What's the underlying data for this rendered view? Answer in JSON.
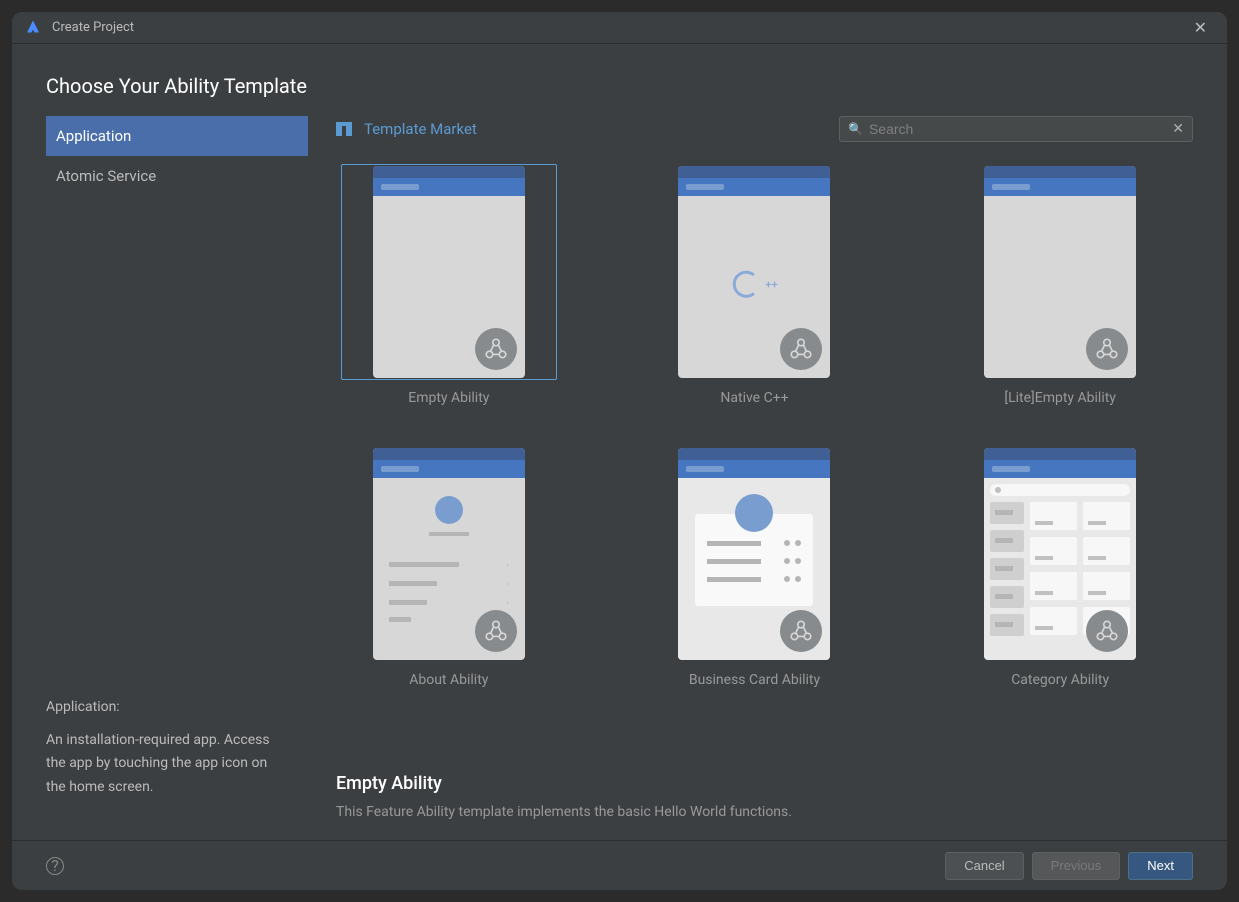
{
  "window": {
    "title": "Create Project"
  },
  "heading": "Choose Your Ability Template",
  "sidebar": {
    "items": [
      {
        "label": "Application",
        "selected": true
      },
      {
        "label": "Atomic Service",
        "selected": false
      }
    ],
    "description_title": "Application:",
    "description_text": "An installation-required app. Access the app by touching the app icon on the home screen."
  },
  "market_link": "Template Market",
  "search": {
    "placeholder": "Search",
    "value": ""
  },
  "templates": [
    {
      "label": "Empty Ability",
      "preview": "empty",
      "selected": true
    },
    {
      "label": "Native C++",
      "preview": "cpp",
      "selected": false
    },
    {
      "label": "[Lite]Empty Ability",
      "preview": "empty",
      "selected": false
    },
    {
      "label": "About Ability",
      "preview": "about",
      "selected": false
    },
    {
      "label": "Business Card Ability",
      "preview": "biz",
      "selected": false
    },
    {
      "label": "Category Ability",
      "preview": "cat",
      "selected": false
    }
  ],
  "detail": {
    "title": "Empty Ability",
    "description": "This Feature Ability template implements the basic Hello World functions."
  },
  "footer": {
    "cancel": "Cancel",
    "previous": "Previous",
    "next": "Next"
  },
  "colors": {
    "accent": "#4a6ea9",
    "link": "#5a9bd4",
    "primary_button": "#365880"
  }
}
